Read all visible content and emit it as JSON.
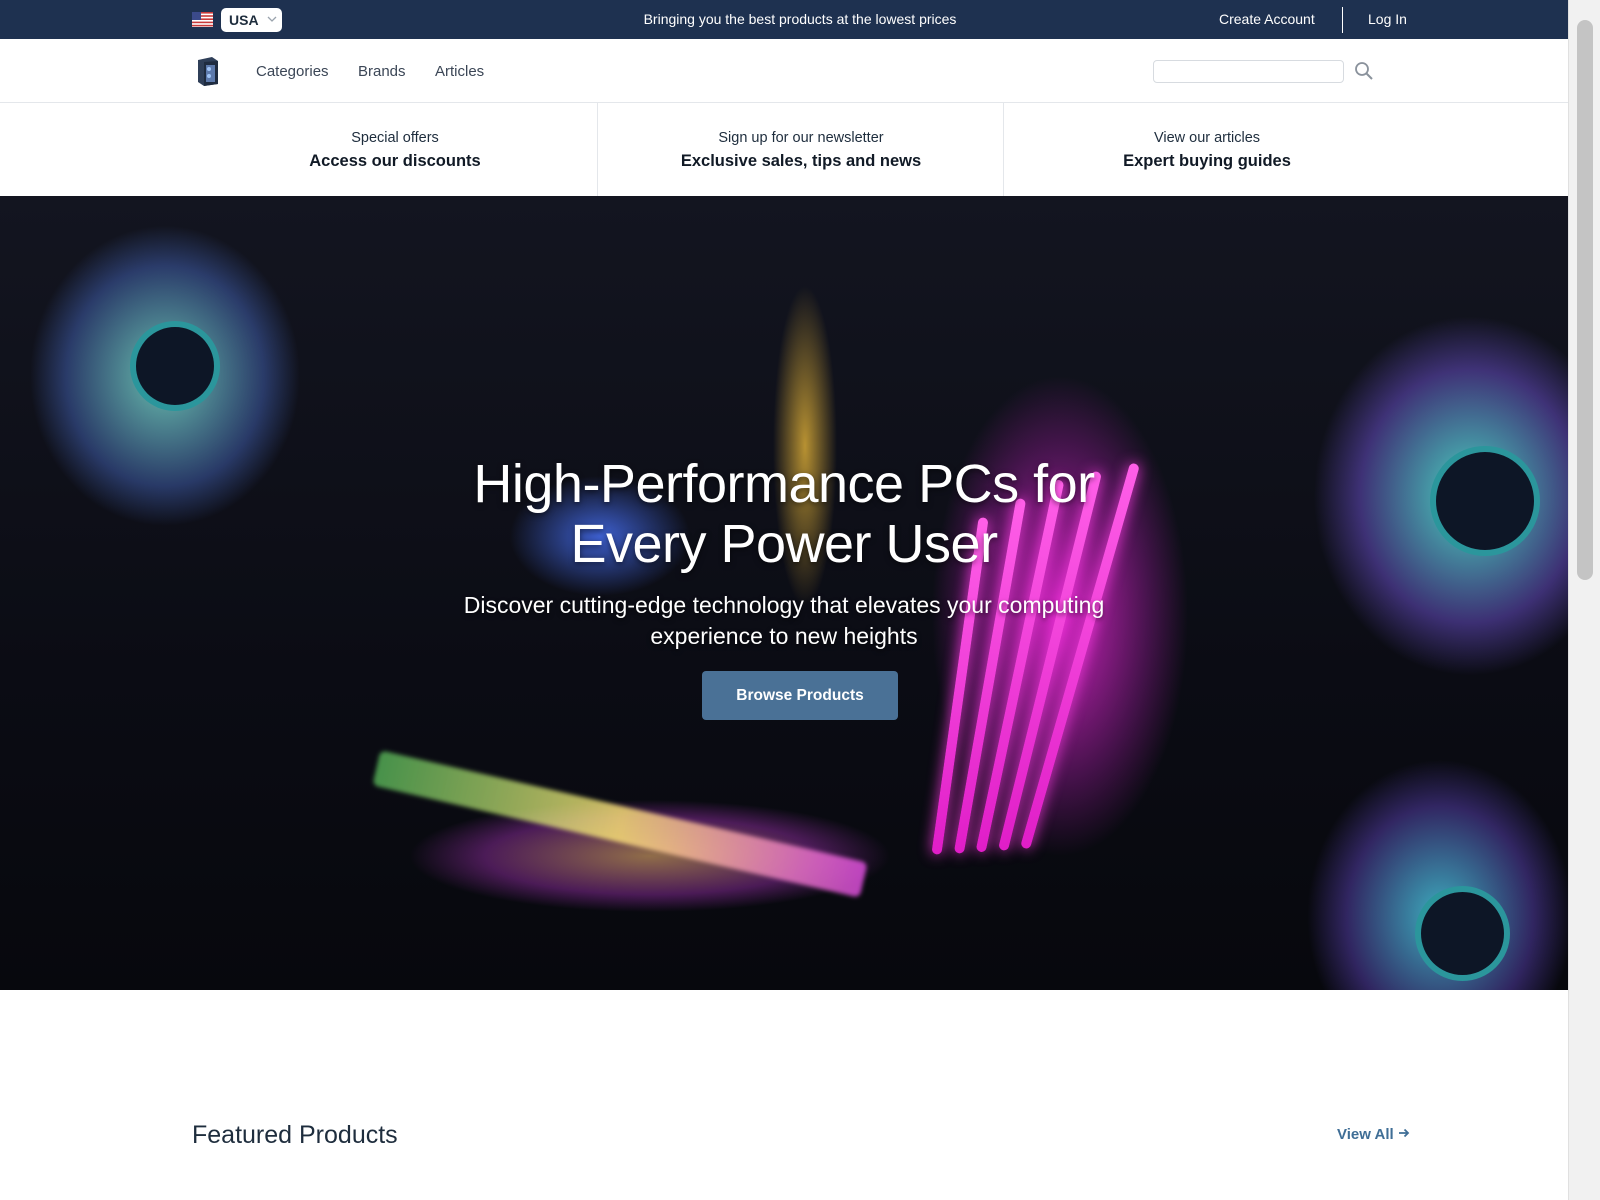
{
  "topbar": {
    "country": "USA",
    "tagline": "Bringing you the best products at the lowest prices",
    "create_account": "Create Account",
    "log_in": "Log In"
  },
  "nav": {
    "links": [
      "Categories",
      "Brands",
      "Articles"
    ],
    "search_placeholder": ""
  },
  "promos": [
    {
      "small": "Special offers",
      "big": "Access our discounts"
    },
    {
      "small": "Sign up for our newsletter",
      "big": "Exclusive sales, tips and news"
    },
    {
      "small": "View our articles",
      "big": "Expert buying guides"
    }
  ],
  "hero": {
    "title_line1": "High-Performance PCs for",
    "title_line2": "Every Power User",
    "subtitle_line1": "Discover cutting-edge technology that elevates your computing",
    "subtitle_line2": "experience to new heights",
    "button": "Browse Products"
  },
  "featured": {
    "title": "Featured Products",
    "view_all": "View All"
  },
  "icons": {
    "flag": "us-flag-icon",
    "dropdown": "chevron-down-icon",
    "logo": "pc-case-logo",
    "search": "search-icon",
    "arrow": "arrow-right-icon"
  },
  "colors": {
    "topbar": "#1e3150",
    "button": "#4a7196",
    "link": "#3f6e96"
  }
}
